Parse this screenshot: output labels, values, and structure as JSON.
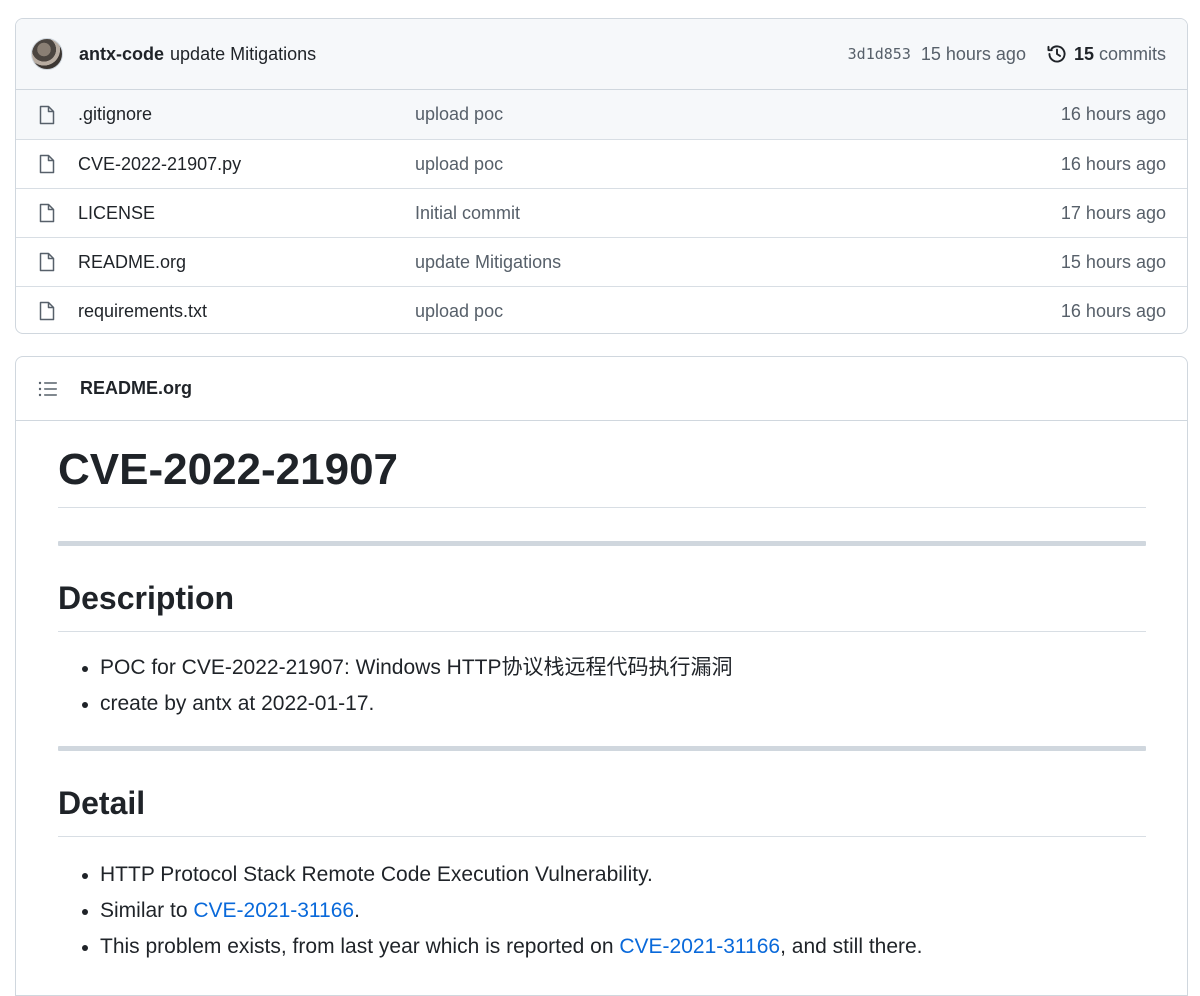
{
  "latest_commit": {
    "author": "antx-code",
    "message": "update Mitigations",
    "sha": "3d1d853",
    "time": "15 hours ago",
    "commits_count": "15",
    "commits_label": "commits"
  },
  "files": [
    {
      "name": ".gitignore",
      "commit": "upload poc",
      "age": "16 hours ago",
      "icon": "file-icon"
    },
    {
      "name": "CVE-2022-21907.py",
      "commit": "upload poc",
      "age": "16 hours ago",
      "icon": "file-icon"
    },
    {
      "name": "LICENSE",
      "commit": "Initial commit",
      "age": "17 hours ago",
      "icon": "file-icon"
    },
    {
      "name": "README.org",
      "commit": "update Mitigations",
      "age": "15 hours ago",
      "icon": "file-icon"
    },
    {
      "name": "requirements.txt",
      "commit": "upload poc",
      "age": "16 hours ago",
      "icon": "file-icon"
    }
  ],
  "readme": {
    "filename": "README.org",
    "title": "CVE-2022-21907",
    "sections": [
      {
        "heading": "Description",
        "items": [
          {
            "text": "POC for CVE-2022-21907: Windows HTTP协议栈远程代码执行漏洞"
          },
          {
            "text": "create by antx at 2022-01-17."
          }
        ]
      },
      {
        "heading": "Detail",
        "items": [
          {
            "text": "HTTP Protocol Stack Remote Code Execution Vulnerability."
          },
          {
            "before": "Similar to ",
            "link": "CVE-2021-31166",
            "after": "."
          },
          {
            "before": "This problem exists, from last year which is reported on ",
            "link": "CVE-2021-31166",
            "after": ", and still there."
          }
        ]
      }
    ]
  },
  "colors": {
    "link": "#0969da",
    "muted": "#57606a",
    "border": "#d0d7de",
    "header_bg": "#f6f8fa"
  }
}
